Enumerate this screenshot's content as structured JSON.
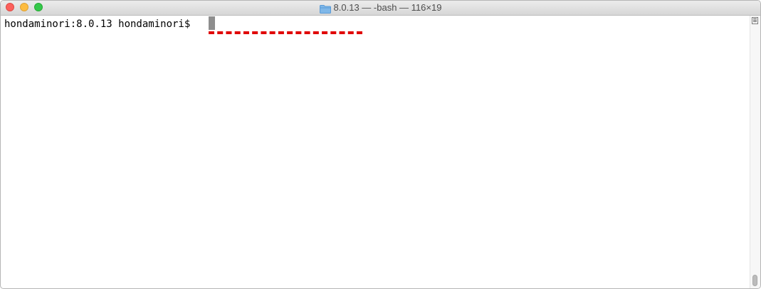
{
  "window": {
    "title": "8.0.13 — -bash — 116×19",
    "title_icon": "folder-icon",
    "traffic_lights": {
      "close": "#fc605c",
      "minimize": "#fdbc40",
      "zoom": "#34c84a"
    }
  },
  "terminal": {
    "prompt": "hondaminori:8.0.13 hondaminori$ ",
    "cursor_color": "#8e8e8e",
    "annotation_color": "#e00000"
  }
}
